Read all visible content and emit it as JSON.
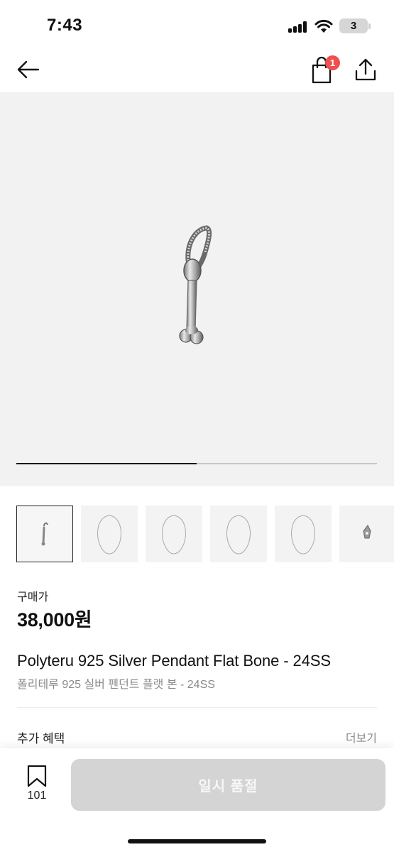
{
  "status_bar": {
    "time": "7:43",
    "battery": "3"
  },
  "top_nav": {
    "back_icon": "arrow-left-icon",
    "bag_icon": "shopping-bag-icon",
    "bag_badge": "1",
    "share_icon": "share-icon"
  },
  "product": {
    "image_icon": "silver-bone-pendant",
    "image_progress": 0.5,
    "thumbnails": [
      {
        "name": "thumbnail-pendant",
        "selected": true
      },
      {
        "name": "thumbnail-necklace-1",
        "selected": false
      },
      {
        "name": "thumbnail-necklace-2",
        "selected": false
      },
      {
        "name": "thumbnail-necklace-3",
        "selected": false
      },
      {
        "name": "thumbnail-necklace-4",
        "selected": false
      },
      {
        "name": "thumbnail-pendant-detail",
        "selected": false
      }
    ],
    "price_label": "구매가",
    "price": "38,000원",
    "title_en": "Polyteru 925 Silver Pendant Flat Bone - 24SS",
    "title_ko": "폴리테루 925 실버 펜던트 플랫 본 - 24SS"
  },
  "benefits": {
    "label": "추가 혜택",
    "more": "더보기"
  },
  "bottom_bar": {
    "bookmark_icon": "bookmark-icon",
    "bookmark_count": "101",
    "soldout_label": "일시 품절"
  },
  "colors": {
    "badge": "#ef4f4f",
    "soldout_bg": "#d4d4d4",
    "hero_bg": "#f2f2f2"
  }
}
